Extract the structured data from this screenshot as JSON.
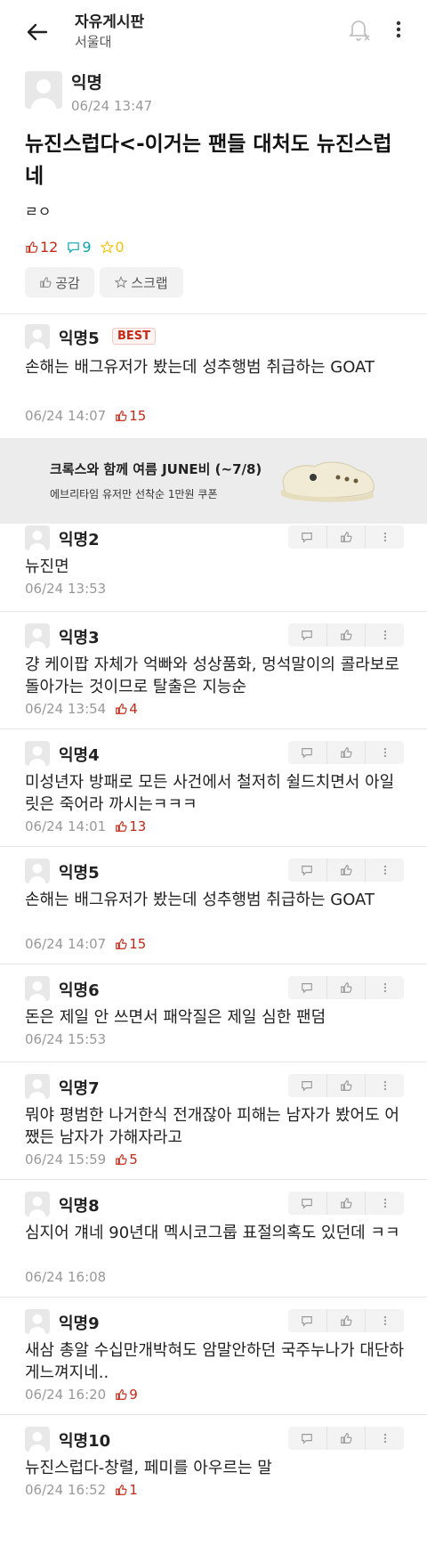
{
  "header": {
    "title": "자유게시판",
    "subtitle": "서울대"
  },
  "post": {
    "author": "익명",
    "time": "06/24 13:47",
    "title": "뉴진스럽다<-이거는 팬들 대처도 뉴진스럽네",
    "body": "ㄹㅇ",
    "likes": "12",
    "comments": "9",
    "scraps": "0",
    "like_button": "공감",
    "scrap_button": "스크랩"
  },
  "best_comment": {
    "author": "익명5",
    "badge": "BEST",
    "text": "손해는 배그유저가 봤는데 성추행범 취급하는 GOAT",
    "time": "06/24 14:07",
    "likes": "15"
  },
  "ad": {
    "title": "크록스와 함께 여름 JUNE비 (~7/8)",
    "subtitle": "에브리타임 유저만 선착순 1만원 쿠폰"
  },
  "comments": [
    {
      "author": "익명2",
      "text": "뉴진면",
      "time": "06/24 13:53",
      "likes": ""
    },
    {
      "author": "익명3",
      "text": "걍 케이팝 자체가 억빠와 성상품화, 멍석말이의 콜라보로 돌아가는 것이므로 탈출은 지능순",
      "time": "06/24 13:54",
      "likes": "4"
    },
    {
      "author": "익명4",
      "text": "미성년자 방패로 모든 사건에서 철저히 쉴드치면서 아일릿은 죽어라 까시는ㅋㅋㅋ",
      "time": "06/24 14:01",
      "likes": "13"
    },
    {
      "author": "익명5",
      "text": "손해는 배그유저가 봤는데 성추행범 취급하는 GOAT",
      "time": "06/24 14:07",
      "likes": "15"
    },
    {
      "author": "익명6",
      "text": "돈은 제일 안 쓰면서 패악질은 제일 심한 팬덤",
      "time": "06/24 15:53",
      "likes": ""
    },
    {
      "author": "익명7",
      "text": "뭐야 평범한 나거한식 전개잖아 피해는 남자가 봤어도 어쨌든 남자가 가해자라고",
      "time": "06/24 15:59",
      "likes": "5"
    },
    {
      "author": "익명8",
      "text": "심지어 걔네 90년대 멕시코그룹 표절의혹도 있던데 ㅋㅋ",
      "time": "06/24 16:08",
      "likes": ""
    },
    {
      "author": "익명9",
      "text": "새삼 총알 수십만개박혀도 암말안하던 국주누나가 대단하게느껴지네..",
      "time": "06/24 16:20",
      "likes": "9"
    },
    {
      "author": "익명10",
      "text": "뉴진스럽다-창렬, 페미를 아우르는 말",
      "time": "06/24 16:52",
      "likes": "1"
    }
  ],
  "colors": {
    "like": "#c62917",
    "comment": "#0ca5b0",
    "scrap": "#f4c20d",
    "best_badge": "#c62917"
  }
}
